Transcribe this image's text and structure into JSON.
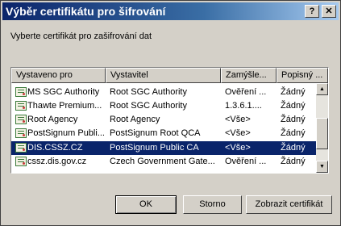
{
  "window": {
    "title": "Výběr certifikátu pro šifrování"
  },
  "titlebar": {
    "help_label": "?",
    "close_label": "✕"
  },
  "instruction": "Vyberte certifikát pro zašifrování dat",
  "table": {
    "columns": [
      "Vystaveno pro",
      "Vystavitel",
      "Zamýšle...",
      "Popisný ..."
    ],
    "rows": [
      {
        "issued_to": "MS SGC Authority",
        "issuer": "Root SGC Authority",
        "purpose": "Ověření ...",
        "friendly": "Žádný"
      },
      {
        "issued_to": "Thawte Premium...",
        "issuer": "Root SGC Authority",
        "purpose": "1.3.6.1....",
        "friendly": "Žádný"
      },
      {
        "issued_to": "Root Agency",
        "issuer": "Root Agency",
        "purpose": "<Vše>",
        "friendly": "Žádný"
      },
      {
        "issued_to": "PostSignum Publi...",
        "issuer": "PostSignum Root QCA",
        "purpose": "<Vše>",
        "friendly": "Žádný"
      },
      {
        "issued_to": "DIS.CSSZ.CZ",
        "issuer": "PostSignum Public CA",
        "purpose": "<Vše>",
        "friendly": "Žádný"
      },
      {
        "issued_to": "cssz.dis.gov.cz",
        "issuer": "Czech Government Gate...",
        "purpose": "Ověření ...",
        "friendly": "Žádný"
      }
    ],
    "selected_index": 4
  },
  "scrollbar": {
    "up_arrow": "▲",
    "down_arrow": "▼"
  },
  "buttons": {
    "ok": "OK",
    "cancel": "Storno",
    "view": "Zobrazit certifikát"
  },
  "colors": {
    "titlebar_start": "#0a246a",
    "titlebar_end": "#a6caf0",
    "selection": "#0a246a",
    "face": "#d4d0c8"
  }
}
